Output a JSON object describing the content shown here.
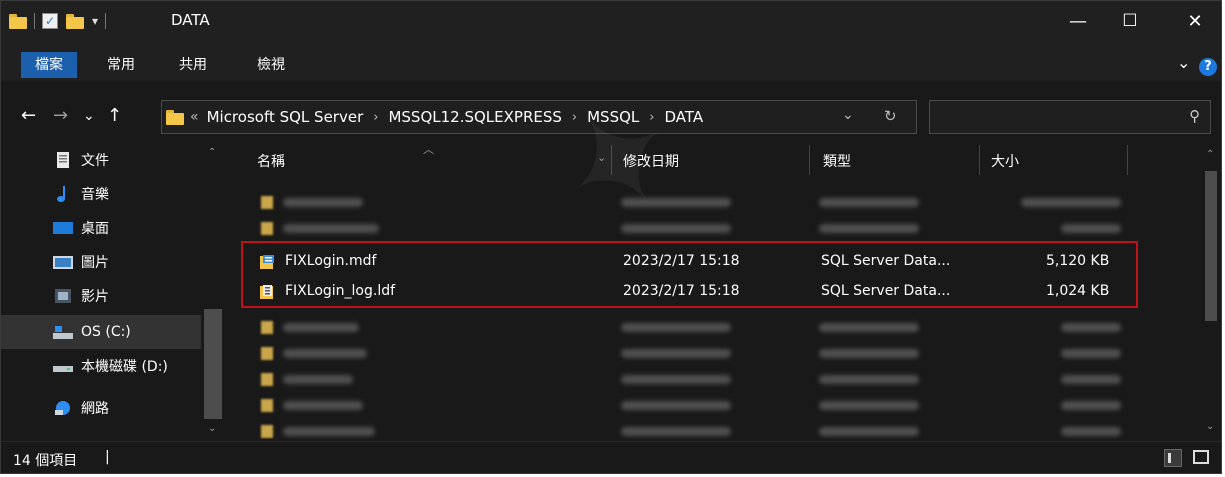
{
  "window": {
    "title": "DATA",
    "minimize_glyph": "—",
    "maximize_glyph": "☐",
    "close_glyph": "✕"
  },
  "ribbon": {
    "tabs": [
      "檔案",
      "常用",
      "共用",
      "檢視"
    ],
    "expand_glyph": "⌄",
    "help_glyph": "?"
  },
  "nav": {
    "back_glyph": "←",
    "forward_glyph": "→",
    "recent_glyph": "⌄",
    "up_glyph": "↑",
    "overflow": "«",
    "breadcrumb": [
      "Microsoft SQL Server",
      "MSSQL12.SQLEXPRESS",
      "MSSQL",
      "DATA"
    ],
    "separator": "›",
    "dropdown_glyph": "⌄",
    "refresh_glyph": "↻",
    "search_glyph": "⚲"
  },
  "sidebar": {
    "items": [
      {
        "label": "文件",
        "icon": "document-icon"
      },
      {
        "label": "音樂",
        "icon": "music-icon"
      },
      {
        "label": "桌面",
        "icon": "desktop-icon"
      },
      {
        "label": "圖片",
        "icon": "pictures-icon"
      },
      {
        "label": "影片",
        "icon": "videos-icon"
      },
      {
        "label": "OS (C:)",
        "icon": "system-drive-icon",
        "selected": true
      },
      {
        "label": "本機磁碟 (D:)",
        "icon": "drive-icon"
      },
      {
        "label": "網路",
        "icon": "network-icon"
      }
    ]
  },
  "columns": {
    "name": "名稱",
    "modified": "修改日期",
    "type": "類型",
    "size": "大小"
  },
  "files": [
    {
      "name": "FIXLogin.mdf",
      "modified": "2023/2/17 15:18",
      "type": "SQL Server Data...",
      "size": "5,120 KB",
      "icon": "database-file-icon"
    },
    {
      "name": "FIXLogin_log.ldf",
      "modified": "2023/2/17 15:18",
      "type": "SQL Server Data...",
      "size": "1,024 KB",
      "icon": "database-log-file-icon"
    }
  ],
  "status": {
    "count": "14 個項目",
    "separator": "|"
  },
  "colors": {
    "accent": "#1b5fad",
    "highlight_border": "#c0121b",
    "background": "#191919"
  }
}
